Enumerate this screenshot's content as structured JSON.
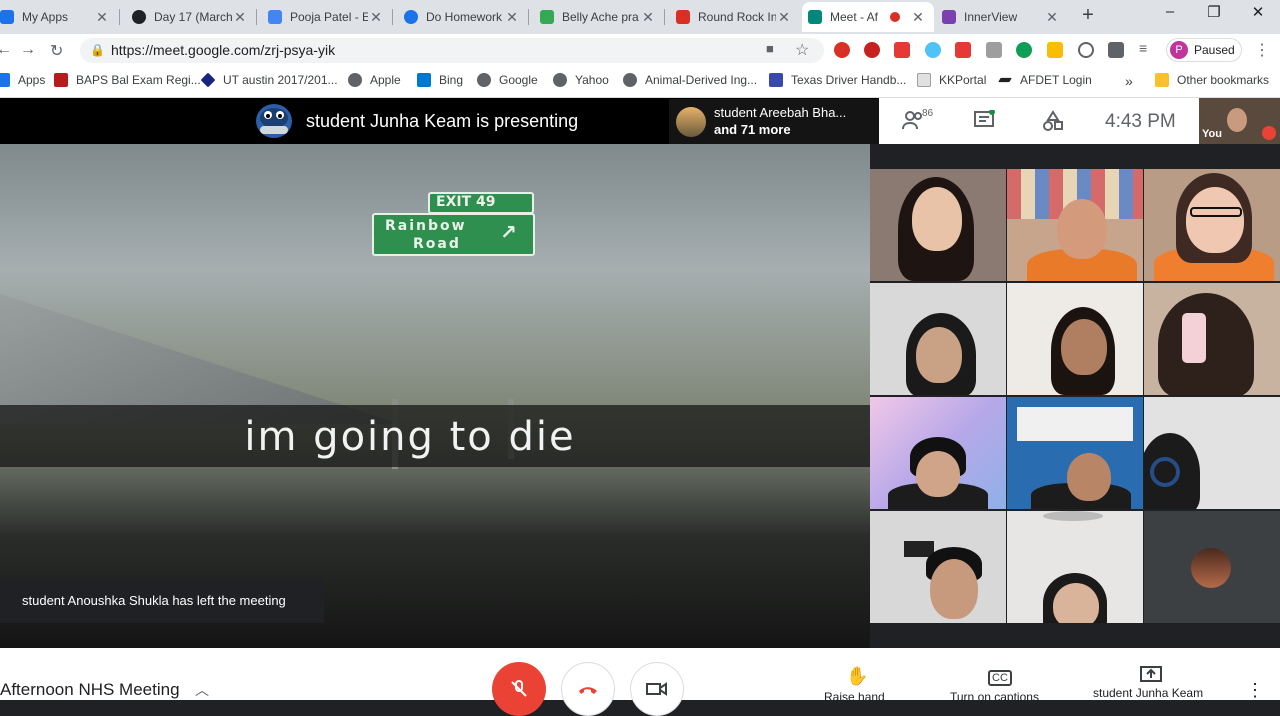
{
  "tabs": [
    {
      "title": "My Apps",
      "color": "#1a73e8"
    },
    {
      "title": "Day 17 (March",
      "color": "#202124"
    },
    {
      "title": "Pooja Patel - E",
      "color": "#4285f4"
    },
    {
      "title": "Do Homework",
      "color": "#1a73e8"
    },
    {
      "title": "Belly Ache pra",
      "color": "#34a853"
    },
    {
      "title": "Round Rock In",
      "color": "#d93025"
    },
    {
      "title": "Meet - Af",
      "color": "#00897b"
    },
    {
      "title": "InnerView",
      "color": "#7b3fb0"
    }
  ],
  "address_bar": {
    "url": "https://meet.google.com/zrj-psya-yik"
  },
  "profile": {
    "initial": "P",
    "status": "Paused"
  },
  "bookmarks": [
    "Apps",
    "BAPS Bal Exam Regi...",
    "UT austin 2017/201...",
    "Apple",
    "Bing",
    "Google",
    "Yahoo",
    "Animal-Derived Ing...",
    "Texas Driver Handb...",
    "KKPortal",
    "AFDET Login",
    "Other bookmarks"
  ],
  "meet": {
    "presenting_text": "student Junha Keam is presenting",
    "others_line1": "student Areebah Bha...",
    "others_line2": "and 71 more",
    "people_count": "86",
    "clock": "4:43  PM",
    "self_label": "You",
    "sign_exit": "EXIT  49",
    "sign_line1": "Rainbow",
    "sign_line2": "Road",
    "caption": "im going to die",
    "toast": "student Anoushka Shukla has left the meeting",
    "meeting_name": "Afternoon NHS Meeting",
    "raise_hand": "Raise hand",
    "captions": "Turn on captions",
    "presenter_label": "student Junha Keam"
  },
  "icons": {
    "people": "people-icon",
    "chat": "chat-icon",
    "activities": "activities-icon",
    "mic_off": "mic-off-icon",
    "hangup": "hangup-icon",
    "camera": "camera-icon",
    "hand": "hand-icon",
    "cc": "captions-icon",
    "present": "present-icon"
  }
}
